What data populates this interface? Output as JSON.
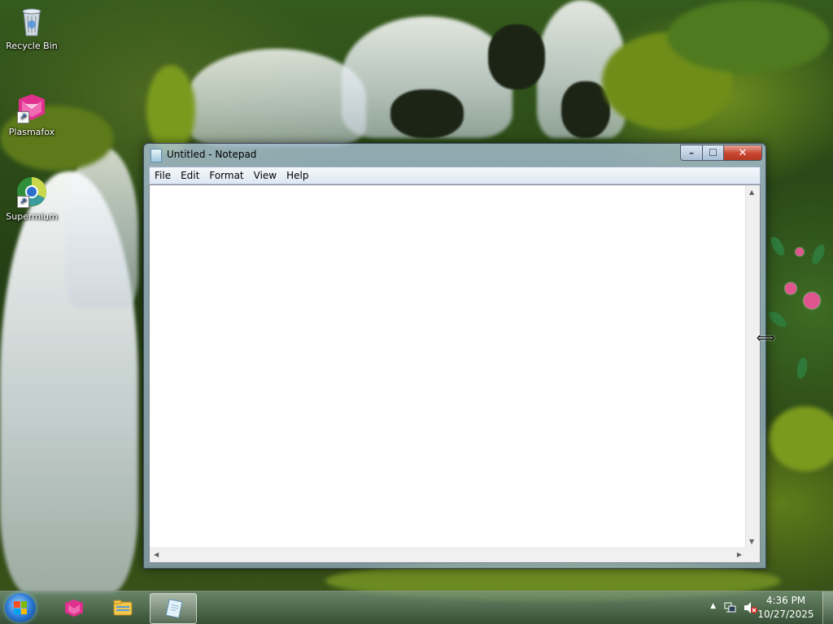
{
  "desktop": {
    "icons": [
      {
        "label": "Recycle Bin",
        "icon": "recycle-bin-icon"
      },
      {
        "label": "Plasmafox",
        "icon": "plasmafox-icon"
      },
      {
        "label": "Supermium",
        "icon": "supermium-icon"
      }
    ]
  },
  "window": {
    "title": "Untitled - Notepad",
    "menu": [
      "File",
      "Edit",
      "Format",
      "View",
      "Help"
    ],
    "content": "",
    "buttons": {
      "minimize": "–",
      "maximize": "☐",
      "close": "✕"
    }
  },
  "taskbar": {
    "pinned": [
      "plasmafox-icon",
      "file-explorer-icon",
      "notepad-icon"
    ],
    "active": "notepad-icon",
    "tray": {
      "show_hidden": "▲",
      "network_icon": "network-icon",
      "volume_icon": "volume-muted-icon"
    },
    "clock": {
      "time": "4:36 PM",
      "date": "10/27/2025"
    }
  },
  "colors": {
    "close_red": "#c9452f",
    "titlebar_glass": "#acc4db",
    "taskbar": "#4a6b52"
  }
}
